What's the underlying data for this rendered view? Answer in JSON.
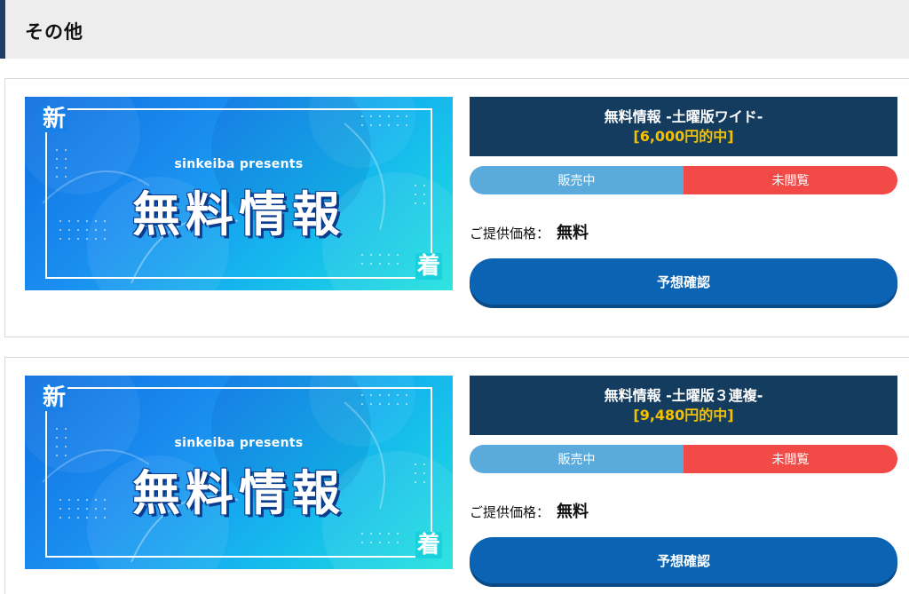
{
  "section": {
    "title": "その他"
  },
  "colors": {
    "header_bg": "#ededed",
    "header_accent": "#1e3f63",
    "title_bg": "#143c5e",
    "hit_color": "#f5c000",
    "sale_color": "#5aabdc",
    "unread_color": "#f24a46",
    "cta_color": "#0a64b3"
  },
  "cards": [
    {
      "banner": {
        "sub": "sinkeiba presents",
        "main": "無料情報",
        "badge_new": "新",
        "badge_arrival": "着"
      },
      "title": "無料情報 -土曜版ワイド-",
      "hit": "[6,000円的中]",
      "status_sale": "販売中",
      "status_unread": "未閲覧",
      "price_label": "ご提供価格：",
      "price_value": "無料",
      "cta": "予想確認"
    },
    {
      "banner": {
        "sub": "sinkeiba presents",
        "main": "無料情報",
        "badge_new": "新",
        "badge_arrival": "着"
      },
      "title": "無料情報 -土曜版３連複-",
      "hit": "[9,480円的中]",
      "status_sale": "販売中",
      "status_unread": "未閲覧",
      "price_label": "ご提供価格：",
      "price_value": "無料",
      "cta": "予想確認"
    }
  ]
}
